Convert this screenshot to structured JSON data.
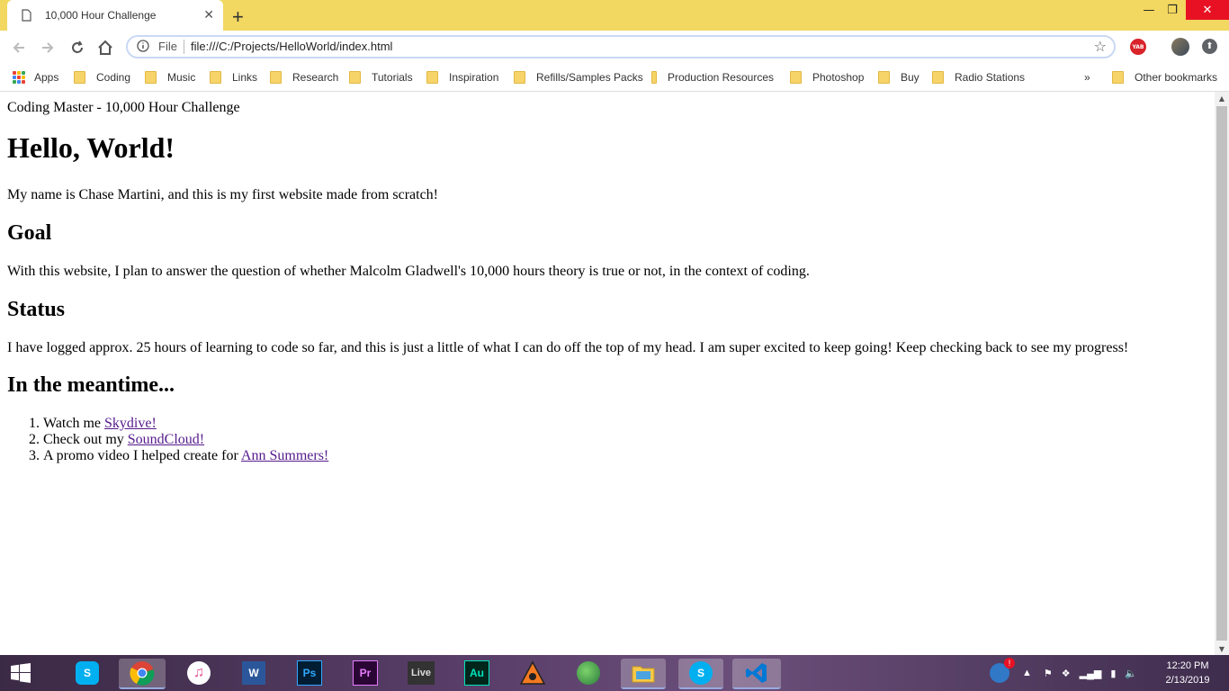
{
  "browser": {
    "tab_title": "10,000 Hour Challenge",
    "omnibox": {
      "scheme_label": "File",
      "url": "file:///C:/Projects/HelloWorld/index.html"
    },
    "extension_label": "YAB",
    "bookmarks": [
      {
        "label": "Apps",
        "icon": "apps-grid-icon"
      },
      {
        "label": "Coding",
        "icon": "folder-icon"
      },
      {
        "label": "Music",
        "icon": "folder-icon"
      },
      {
        "label": "Links",
        "icon": "folder-icon"
      },
      {
        "label": "Research",
        "icon": "folder-icon"
      },
      {
        "label": "Tutorials",
        "icon": "folder-icon"
      },
      {
        "label": "Inspiration",
        "icon": "folder-icon"
      },
      {
        "label": "Refills/Samples Packs",
        "icon": "folder-icon"
      },
      {
        "label": "Production Resources",
        "icon": "folder-icon"
      },
      {
        "label": "Photoshop",
        "icon": "folder-icon"
      },
      {
        "label": "Buy",
        "icon": "folder-icon"
      },
      {
        "label": "Radio Stations",
        "icon": "folder-icon"
      }
    ],
    "overflow_label": "»",
    "other_bookmarks": "Other bookmarks",
    "accent": "#f2d760"
  },
  "page": {
    "top_text": "Coding Master - 10,000 Hour Challenge",
    "h1": "Hello, World!",
    "intro": "My name is Chase Martini, and this is my first website made from scratch!",
    "goal_heading": "Goal",
    "goal_text": "With this website, I plan to answer the question of whether Malcolm Gladwell's 10,000 hours theory is true or not, in the context of coding.",
    "status_heading": "Status",
    "status_text": "I have logged approx. 25 hours of learning to code so far, and this is just a little of what I can do off the top of my head. I am super excited to keep going! Keep checking back to see my progress!",
    "meantime_heading": "In the meantime...",
    "list": [
      {
        "prefix": "Watch me ",
        "link": "Skydive!"
      },
      {
        "prefix": "Check out my ",
        "link": "SoundCloud!"
      },
      {
        "prefix": "A promo video I helped create for ",
        "link": "Ann Summers!"
      }
    ]
  },
  "taskbar": {
    "apps": [
      {
        "name": "skype",
        "label": ""
      },
      {
        "name": "chrome",
        "label": ""
      },
      {
        "name": "itunes",
        "label": ""
      },
      {
        "name": "word",
        "label": "W"
      },
      {
        "name": "photoshop",
        "label": "Ps"
      },
      {
        "name": "premiere",
        "label": "Pr"
      },
      {
        "name": "ableton-live",
        "label": "Live"
      },
      {
        "name": "audition",
        "label": "Au"
      },
      {
        "name": "reason",
        "label": ""
      },
      {
        "name": "maps",
        "label": ""
      },
      {
        "name": "file-explorer",
        "label": ""
      },
      {
        "name": "skype-2",
        "label": ""
      },
      {
        "name": "vscode",
        "label": ""
      }
    ],
    "clock_time": "12:20 PM",
    "clock_date": "2/13/2019"
  }
}
